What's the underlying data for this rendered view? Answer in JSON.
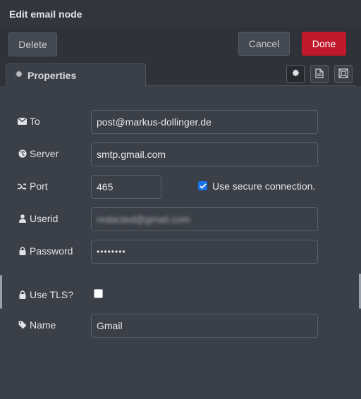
{
  "dialog": {
    "title": "Edit email node"
  },
  "toolbar": {
    "delete_label": "Delete",
    "cancel_label": "Cancel",
    "done_label": "Done",
    "done_color": "#c0192b"
  },
  "tabs": {
    "properties_label": "Properties",
    "icons": [
      "gear-icon",
      "document-icon",
      "frame-icon"
    ]
  },
  "form": {
    "to": {
      "label": "To",
      "icon": "envelope-icon",
      "value": "post@markus-dollinger.de"
    },
    "server": {
      "label": "Server",
      "icon": "globe-icon",
      "value": "smtp.gmail.com"
    },
    "port": {
      "label": "Port",
      "icon": "shuffle-icon",
      "value": "465"
    },
    "secure": {
      "label": "Use secure connection.",
      "checked": true
    },
    "userid": {
      "label": "Userid",
      "icon": "user-icon",
      "value": "redacted@gmail.com"
    },
    "password": {
      "label": "Password",
      "icon": "lock-icon",
      "value": "••••••••"
    },
    "tls": {
      "label": "Use TLS?",
      "icon": "lock-icon",
      "checked": false
    },
    "name": {
      "label": "Name",
      "icon": "tag-icon",
      "value": "Gmail"
    }
  }
}
